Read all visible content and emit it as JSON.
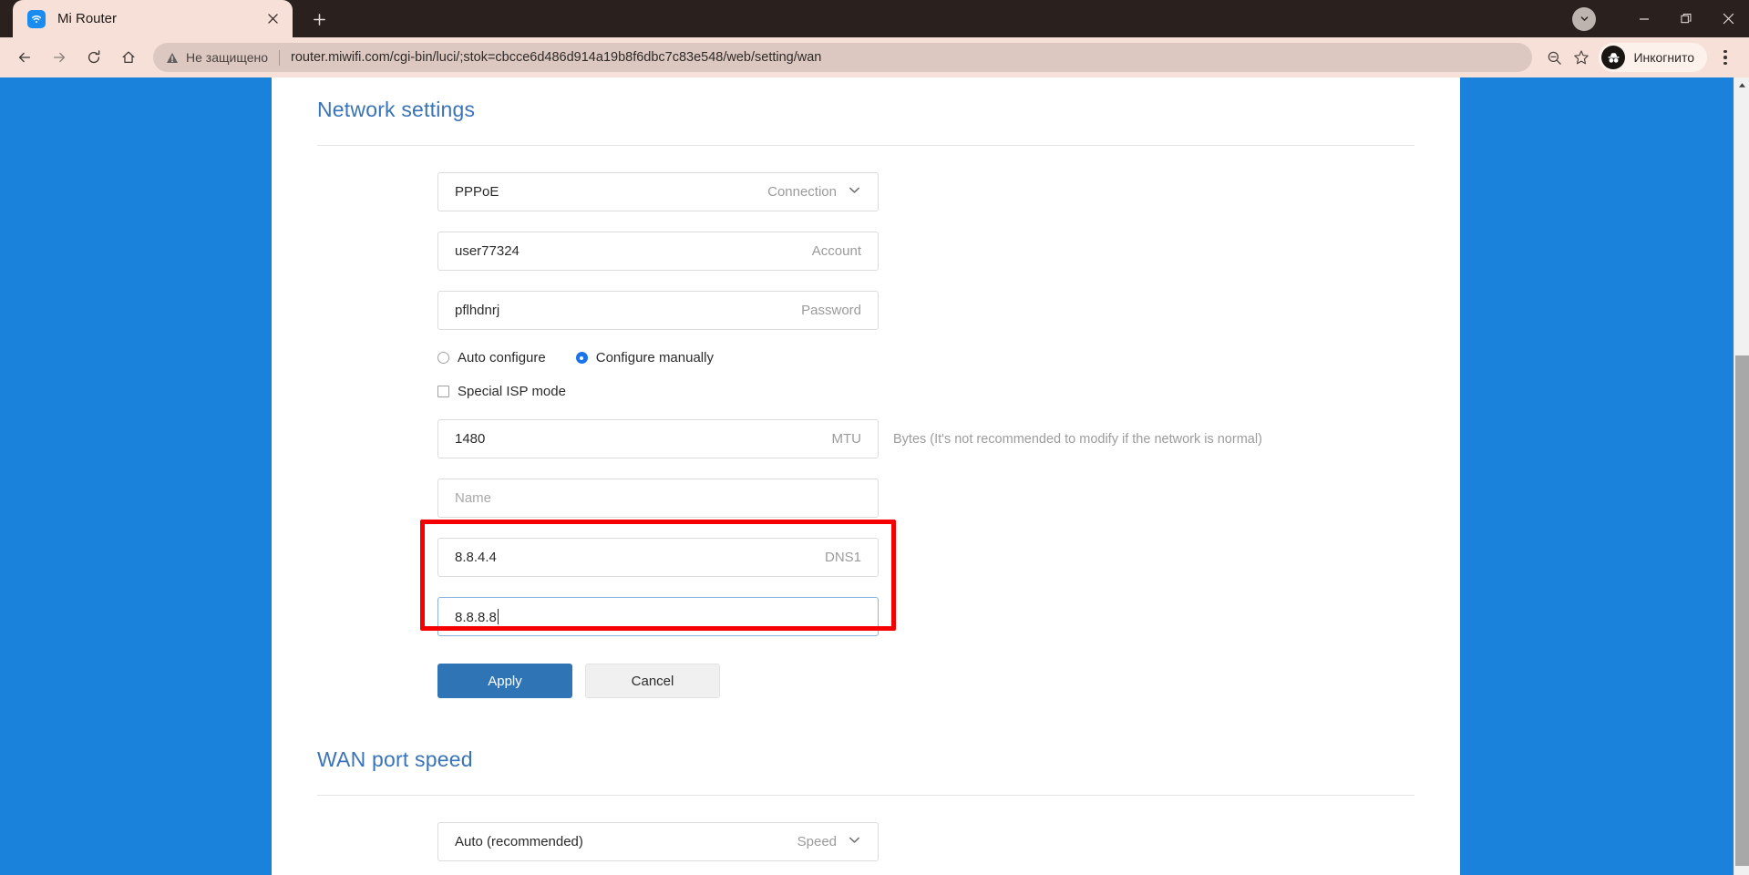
{
  "browser": {
    "tab": {
      "title": "Mi Router",
      "favicon_icon": "wifi-icon",
      "close_icon": "close-icon"
    },
    "new_tab_label": "+",
    "window_controls": {
      "tab_search_icon": "chevron-down-icon",
      "minimize_label": "—",
      "maximize_icon": "restore-icon",
      "close_label": "✕"
    },
    "toolbar": {
      "back_icon": "arrow-left-icon",
      "forward_icon": "arrow-right-icon",
      "reload_icon": "reload-icon",
      "home_icon": "home-icon",
      "security_warning_icon": "warning-triangle-icon",
      "security_text": "Не защищено",
      "url": "router.miwifi.com/cgi-bin/luci/;stok=cbcce6d486d914a19b8f6dbc7c83e548/web/setting/wan",
      "zoom_out_icon": "zoom-out-icon",
      "bookmark_icon": "star-icon",
      "profile_icon": "incognito-icon",
      "profile_label": "Инкогнито",
      "menu_icon": "more-vertical-icon"
    }
  },
  "page": {
    "network_settings": {
      "title": "Network settings",
      "connection": {
        "value": "PPPoE",
        "label": "Connection",
        "chevron_icon": "chevron-down-icon"
      },
      "account": {
        "value": "user77324",
        "label": "Account"
      },
      "password": {
        "value": "pflhdnrj",
        "label": "Password"
      },
      "config_mode": {
        "options": [
          {
            "label": "Auto configure",
            "selected": false
          },
          {
            "label": "Configure manually",
            "selected": true
          }
        ]
      },
      "special_isp": {
        "label": "Special ISP mode",
        "checked": false
      },
      "mtu": {
        "value": "1480",
        "label": "MTU",
        "hint": "Bytes (It's not recommended to modify if the network is normal)"
      },
      "name": {
        "placeholder": "Name",
        "label": ""
      },
      "dns1": {
        "value": "8.8.4.4",
        "label": "DNS1"
      },
      "dns2": {
        "value": "8.8.8.8",
        "label": "",
        "focused": true
      },
      "annotation_color": "#f40000",
      "apply_label": "Apply",
      "cancel_label": "Cancel"
    },
    "wan_port_speed": {
      "title": "WAN port speed",
      "speed": {
        "value": "Auto (recommended)",
        "label": "Speed",
        "chevron_icon": "chevron-down-icon"
      }
    }
  },
  "colors": {
    "page_background": "#1a82da",
    "heading": "#3a74b8",
    "primary_button": "#2f75b6",
    "annotation": "#f40000",
    "radio_selected": "#1a73e8"
  }
}
